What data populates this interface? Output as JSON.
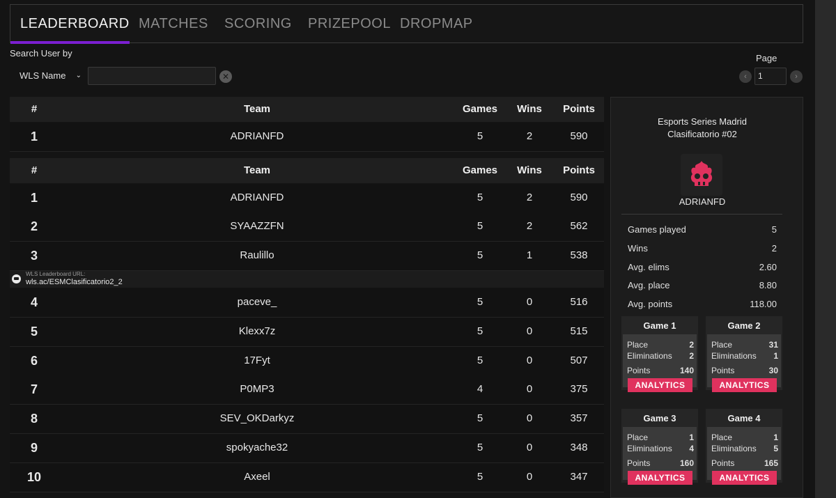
{
  "tabs": [
    {
      "label": "LEADERBOARD"
    },
    {
      "label": "MATCHES"
    },
    {
      "label": "SCORING"
    },
    {
      "label": "PRIZEPOOL"
    },
    {
      "label": "DROPMAP"
    }
  ],
  "search": {
    "label": "Search User by",
    "field_selected": "WLS Name",
    "input_value": ""
  },
  "pagination": {
    "label": "Page",
    "value": "1"
  },
  "table_headers": {
    "rank": "#",
    "team": "Team",
    "games": "Games",
    "wins": "Wins",
    "points": "Points"
  },
  "pinned_row": {
    "rank": "1",
    "team": "ADRIANFD",
    "games": "5",
    "wins": "2",
    "points": "590"
  },
  "rows": [
    {
      "rank": "1",
      "team": "ADRIANFD",
      "games": "5",
      "wins": "2",
      "points": "590"
    },
    {
      "rank": "2",
      "team": "SYAAZZFN",
      "games": "5",
      "wins": "2",
      "points": "562"
    },
    {
      "rank": "3",
      "team": "Raulillo",
      "games": "5",
      "wins": "1",
      "points": "538"
    },
    {
      "rank": "4",
      "team": "paceve_",
      "games": "5",
      "wins": "0",
      "points": "516"
    },
    {
      "rank": "5",
      "team": "Klexx7z",
      "games": "5",
      "wins": "0",
      "points": "515"
    },
    {
      "rank": "6",
      "team": "17Fyt",
      "games": "5",
      "wins": "0",
      "points": "507"
    },
    {
      "rank": "7",
      "team": "P0MP3",
      "games": "4",
      "wins": "0",
      "points": "375"
    },
    {
      "rank": "8",
      "team": "SEV_OKDarkyz",
      "games": "5",
      "wins": "0",
      "points": "357"
    },
    {
      "rank": "9",
      "team": "spokyache32",
      "games": "5",
      "wins": "0",
      "points": "348"
    },
    {
      "rank": "10",
      "team": "Axeel",
      "games": "5",
      "wins": "0",
      "points": "347"
    }
  ],
  "wls_banner": {
    "caption": "WLS Leaderboard URL:",
    "url": "wls.ac/ESMClasificatorio2_2"
  },
  "panel": {
    "title_line1": "Esports Series Madrid",
    "title_line2": "Clasificatorio #02",
    "team": "ADRIANFD",
    "logo_color": "#e0325e",
    "stats": [
      {
        "label": "Games played",
        "value": "5"
      },
      {
        "label": "Wins",
        "value": "2"
      },
      {
        "label": "Avg. elims",
        "value": "2.60"
      },
      {
        "label": "Avg. place",
        "value": "8.80"
      },
      {
        "label": "Avg. points",
        "value": "118.00"
      }
    ],
    "games": [
      {
        "title": "Game 1",
        "place_label": "Place",
        "place": "2",
        "elims_label": "Eliminations",
        "elims": "2",
        "points_label": "Points",
        "points": "140",
        "button": "ANALYTICS"
      },
      {
        "title": "Game 2",
        "place_label": "Place",
        "place": "31",
        "elims_label": "Eliminations",
        "elims": "1",
        "points_label": "Points",
        "points": "30",
        "button": "ANALYTICS"
      },
      {
        "title": "Game 3",
        "place_label": "Place",
        "place": "1",
        "elims_label": "Eliminations",
        "elims": "4",
        "points_label": "Points",
        "points": "160",
        "button": "ANALYTICS"
      },
      {
        "title": "Game 4",
        "place_label": "Place",
        "place": "1",
        "elims_label": "Eliminations",
        "elims": "5",
        "points_label": "Points",
        "points": "165",
        "button": "ANALYTICS"
      }
    ]
  }
}
